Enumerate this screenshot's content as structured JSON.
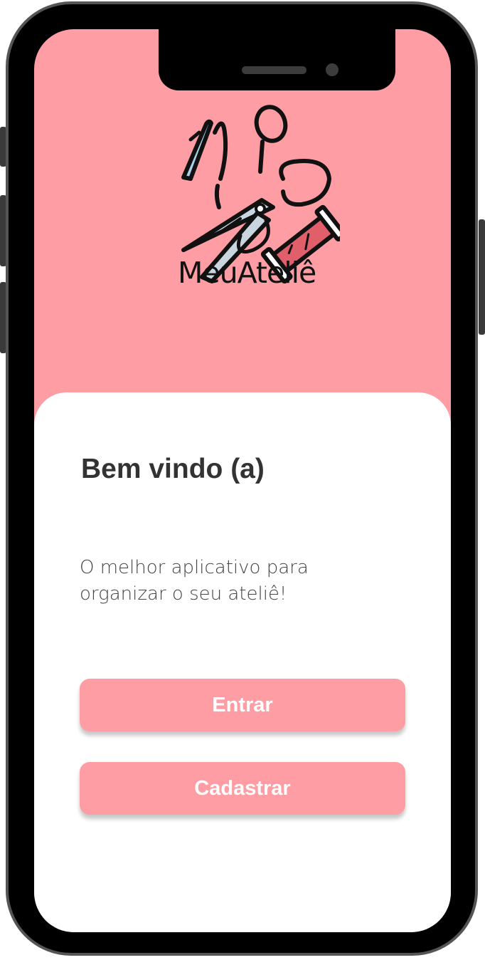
{
  "app": {
    "logo_text": "MeuAteliê"
  },
  "welcome": {
    "title": "Bem vindo (a)",
    "subtitle": "O melhor aplicativo para organizar o seu ateliê!"
  },
  "buttons": {
    "enter_label": "Entrar",
    "register_label": "Cadastrar"
  },
  "colors": {
    "brand_pink": "#fe9ea4",
    "card_background": "#ffffff",
    "frame": "#000000"
  },
  "icons": {
    "logo": "sewing-needle-scissors-thread-icon"
  }
}
